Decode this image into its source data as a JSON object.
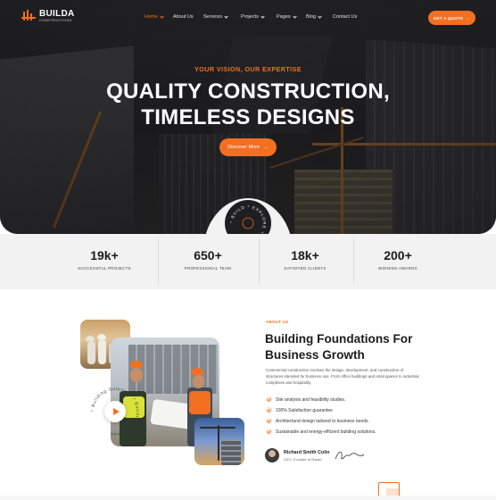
{
  "brand": {
    "name": "BUILDA",
    "tagline": "CONSTRUCTIONS"
  },
  "nav": {
    "items": [
      {
        "label": "Home",
        "active": true,
        "dropdown": true
      },
      {
        "label": "About Us",
        "active": false,
        "dropdown": false
      },
      {
        "label": "Services",
        "active": false,
        "dropdown": true
      },
      {
        "label": "Projects",
        "active": false,
        "dropdown": true
      },
      {
        "label": "Pages",
        "active": false,
        "dropdown": true
      },
      {
        "label": "Blog",
        "active": false,
        "dropdown": true
      },
      {
        "label": "Contact Us",
        "active": false,
        "dropdown": false
      }
    ],
    "cta_label": "GET A QUOTE"
  },
  "hero": {
    "kicker": "YOUR VISION, OUR EXPERTISE",
    "title_line1": "QUALITY CONSTRUCTION,",
    "title_line2": "TIMELESS DESIGNS",
    "button_label": "Discover More",
    "badge_text": "* BUILD * EXPLORE * DESIGN "
  },
  "stats": [
    {
      "value": "19k+",
      "label": "SUCCESSFUL PROJECTS"
    },
    {
      "value": "650+",
      "label": "PROFESSIONAL TEAM"
    },
    {
      "value": "18k+",
      "label": "SATISFIED CLIENTS"
    },
    {
      "value": "200+",
      "label": "WINNING AWARDS"
    }
  ],
  "about": {
    "kicker": "ABOUT US",
    "title_line1": "Building Foundations For",
    "title_line2": "Business Growth",
    "description": "Commercial construction involves the design, development, and construction of structures intended for business use. From office buildings and retail spaces to industrial complexes and hospitality.",
    "ring_text": "* Building Solutions * Building Solutions ",
    "features": [
      "Site analysis and feasibility studies.",
      "100% Satisfaction guarantee",
      "Architectural design tailored to business needs.",
      "Sustainable and energy-efficient building solutions."
    ],
    "ceo_name": "Richard Smith Colin",
    "ceo_role": "CEO, Founder of Rawel"
  },
  "colors": {
    "accent": "#f36f21",
    "dark": "#1f1f21",
    "stats_bg": "#f2f2f2"
  },
  "icons": [
    "logo-mark-icon",
    "chevron-down-icon",
    "arrow-right-icon",
    "play-icon",
    "check-icon",
    "signature-icon"
  ]
}
